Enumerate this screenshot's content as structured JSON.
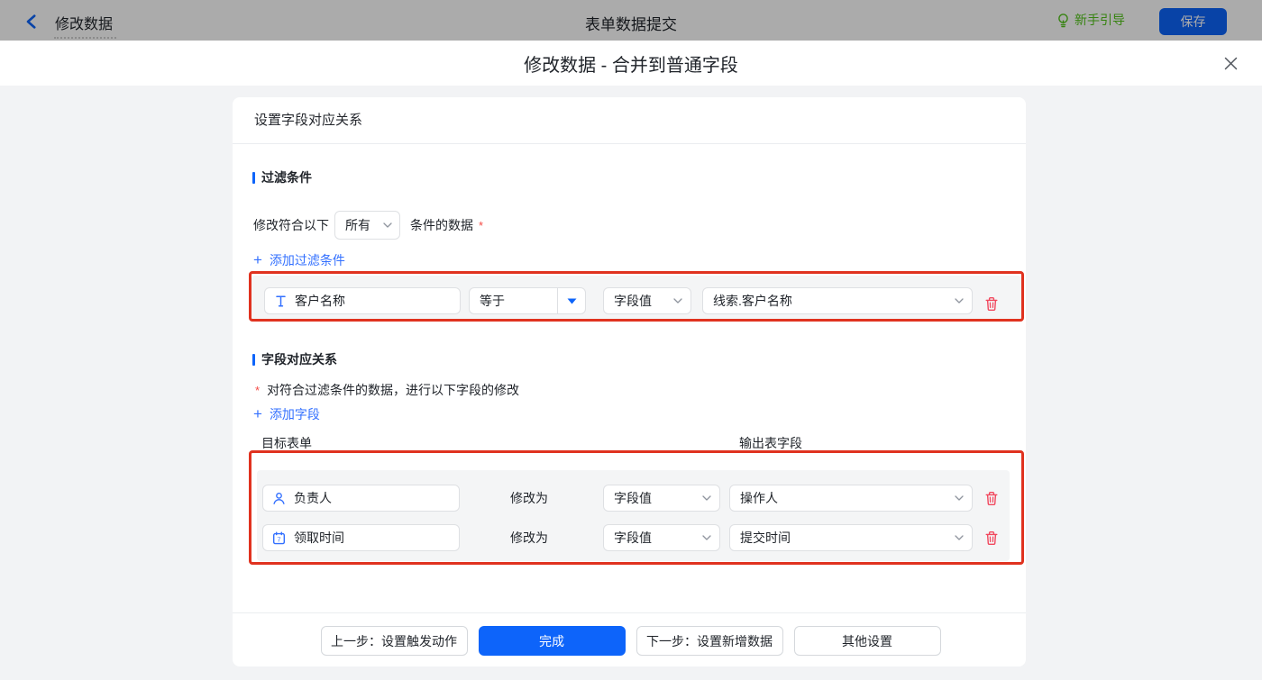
{
  "colors": {
    "accent_blue": "#0d64fa",
    "link_blue": "#3370ff",
    "icon_blue": "#3370ff",
    "guide_green": "#52c41a",
    "highlight_red": "#e0321f",
    "trash_red": "#f1485e",
    "asterisk_red": "#f54a45",
    "panel_gray": "#f4f5f6",
    "page_bg": "#f2f3f5"
  },
  "topbar": {
    "back_icon": "back-chevron-icon",
    "node_name": "修改数据",
    "center_title": "表单数据提交",
    "guide_icon": "bulb-icon",
    "guide_label": "新手引导",
    "save_label": "保存"
  },
  "modal": {
    "title": "修改数据 - 合并到普通字段",
    "close_icon": "close-icon"
  },
  "card": {
    "title": "设置字段对应关系"
  },
  "filter": {
    "section_title": "过滤条件",
    "cond_prefix": "修改符合以下",
    "scope_value": "所有",
    "cond_suffix": "条件的数据",
    "required_mark": "*",
    "add_label": "添加过滤条件",
    "row": {
      "field_icon": "text-field-icon",
      "field": "客户名称",
      "operator": "等于",
      "value_type": "字段值",
      "value": "线索.客户名称",
      "delete_icon": "trash-icon"
    }
  },
  "mapping": {
    "section_title": "字段对应关系",
    "required_mark": "*",
    "hint": "对符合过滤条件的数据，进行以下字段的修改",
    "add_label": "添加字段",
    "col_target": "目标表单",
    "col_output": "输出表字段",
    "modify_label": "修改为",
    "rows": [
      {
        "field_icon": "person-icon",
        "field": "负责人",
        "modify_label": "修改为",
        "value_type": "字段值",
        "value": "操作人",
        "delete_icon": "trash-icon"
      },
      {
        "field_icon": "calendar-icon",
        "field": "领取时间",
        "modify_label": "修改为",
        "value_type": "字段值",
        "value": "提交时间",
        "delete_icon": "trash-icon"
      }
    ]
  },
  "footer": {
    "prev": "上一步：设置触发动作",
    "finish": "完成",
    "next": "下一步：设置新增数据",
    "other": "其他设置"
  }
}
